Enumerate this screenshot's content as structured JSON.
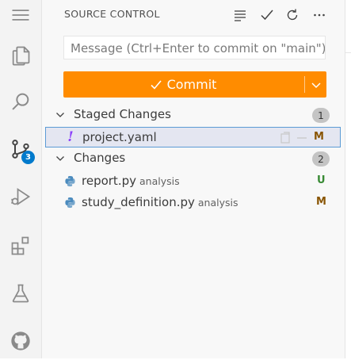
{
  "activity_bar": {
    "items": [
      {
        "name": "explorer",
        "icon": "files-icon"
      },
      {
        "name": "search",
        "icon": "search-icon"
      },
      {
        "name": "source-control",
        "icon": "source-control-icon",
        "badge": "3"
      },
      {
        "name": "run-debug",
        "icon": "run-debug-icon"
      },
      {
        "name": "extensions",
        "icon": "extensions-icon"
      },
      {
        "name": "testing",
        "icon": "flask-icon"
      },
      {
        "name": "github",
        "icon": "github-icon"
      }
    ]
  },
  "sidebar": {
    "title": "SOURCE CONTROL",
    "actions": [
      "list-icon",
      "check-icon",
      "refresh-icon",
      "ellipsis-icon"
    ],
    "message_placeholder": "Message (Ctrl+Enter to commit on \"main\")",
    "commit_label": "Commit",
    "commit_color": "#ff8c00",
    "staged": {
      "label": "Staged Changes",
      "count": "1",
      "files": [
        {
          "name": "project.yaml",
          "dir": "",
          "status": "M",
          "status_color": "#895503",
          "icon": "exclamation-icon"
        }
      ]
    },
    "changes": {
      "label": "Changes",
      "count": "2",
      "files": [
        {
          "name": "report.py",
          "dir": "analysis",
          "status": "U",
          "status_color": "#388a34",
          "icon": "python-icon"
        },
        {
          "name": "study_definition.py",
          "dir": "analysis",
          "status": "M",
          "status_color": "#895503",
          "icon": "python-icon"
        }
      ]
    }
  }
}
